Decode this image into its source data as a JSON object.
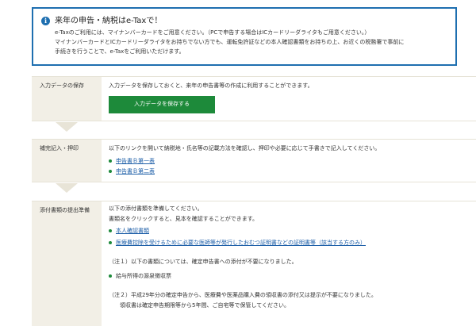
{
  "info": {
    "icon": "info-icon",
    "title": "来年の申告・納税はe-Taxで！",
    "lines": [
      "e-Taxのご利用には、マイナンバーカードをご用意ください。（PCで申告する場合はICカードリーダライタもご用意ください。）",
      "マイナンバーカードとICカードリーダライタをお持ちでない方でも、運転免許証などの本人確認書類をお持ちの上、お近くの税務署で事前に",
      "手続きを行うことで、e-Taxをご利用いただけます。"
    ]
  },
  "steps": [
    {
      "heading": "入力データの保存",
      "text": "入力データを保存しておくと、来年の申告書等の作成に利用することができます。",
      "button": "入力データを保存する"
    },
    {
      "heading": "補完記入・押印",
      "text": "以下のリンクを開いて納税地・氏名等の記載方法を確認し、押印や必要に応じて手書きで記入してください。",
      "links": [
        "申告書Ｂ第一表",
        "申告書Ｂ第二表"
      ]
    },
    {
      "heading": "添付書類の提出準備",
      "lines": [
        "以下の添付書類を準備してください。",
        "書類名をクリックすると、見本を確認することができます。"
      ],
      "links": [
        "本人確認書類",
        "医療費控除を受けるために必要な医師等が発行したおむつ証明書などの証明書等（該当する方のみ）"
      ],
      "note1": "（注１）以下の書類については、確定申告書への添付が不要になりました。",
      "note1_item": "給与所得の源泉徴収票",
      "note2_lines": [
        "（注２）平成29年分の確定申告から、医療費や医薬品購入費の領収書の添付又は提示が不要になりました。",
        "　　領収書は確定申告期限等から5年間、ご自宅等で保管してください。"
      ]
    }
  ],
  "colors": {
    "accent": "#1e6fb0",
    "button": "#1d8a3a",
    "link": "#1e5fa8",
    "head_bg": "#f2efe6"
  }
}
